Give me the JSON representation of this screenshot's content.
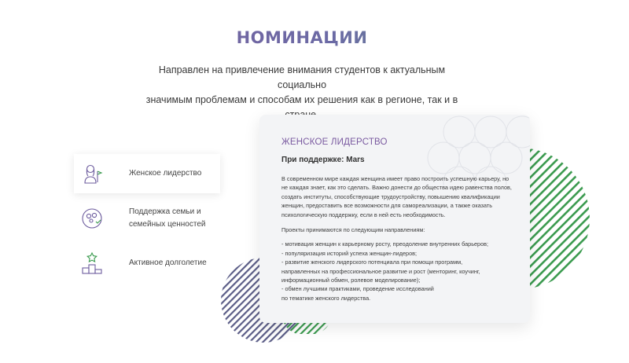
{
  "header": {
    "title": "НОМИНАЦИИ",
    "intro_line1": "Направлен на привлечение внимания студентов к актуальным социально",
    "intro_line2": "значимым проблемам и способам  их решения как в регионе, так и в стране."
  },
  "nominations": [
    {
      "label": "Женское лидерство",
      "icon": "woman-leader-icon",
      "active": true
    },
    {
      "label_line1": "Поддержка семьи и",
      "label_line2": "семейных ценностей",
      "icon": "family-icon",
      "active": false
    },
    {
      "label": "Активное долголетие",
      "icon": "podium-icon",
      "active": false
    }
  ],
  "card": {
    "title": "ЖЕНСКОЕ ЛИДЕРСТВО",
    "sponsor": "При поддержке: Mars",
    "paragraph1": "В современном мире каждая женщина имеет право построить успешную карьеру, но не каждая знает, как это сделать. Важно донести до общества идею равенства полов, создать институты, способствующие трудоустройству, повышению квалификации женщин, предоставить все возможности для самореализации, а также оказать психологическую поддержку, если в ней есть необходимость.",
    "paragraph2": "Проекты принимаются по следующим направлениям:",
    "list": [
      "- мотивация женщин к карьерному росту, преодоление внутренних барьеров;",
      "- популяризация историй успеха женщин-лидеров;",
      "- развитие женского лидерского потенциала при помощи программ,",
      "направленных на профессиональное развитие и рост (менторинг, коучинг,",
      "информационный обмен, ролевое моделирование);",
      "- обмен лучшими практиками, проведение исследований",
      "по тематике женского лидерства."
    ]
  },
  "colors": {
    "accent_purple": "#7a5aa0",
    "accent_green": "#3a9a4e",
    "stripe_purple": "#5a5c86"
  }
}
